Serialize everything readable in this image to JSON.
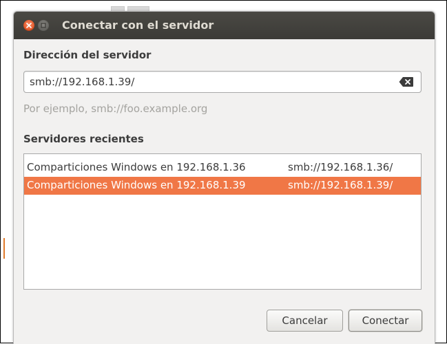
{
  "window": {
    "title": "Conectar con el servidor"
  },
  "server_address": {
    "label": "Dirección del servidor",
    "value": "smb://192.168.1.39/",
    "example": "Por ejemplo, smb://foo.example.org"
  },
  "recent_servers": {
    "label": "Servidores recientes",
    "items": [
      {
        "name": "Comparticiones Windows en 192.168.1.36",
        "uri": "smb://192.168.1.36/",
        "selected": false
      },
      {
        "name": "Comparticiones Windows en 192.168.1.39",
        "uri": "smb://192.168.1.39/",
        "selected": true
      }
    ]
  },
  "buttons": {
    "cancel": "Cancelar",
    "connect": "Conectar"
  },
  "colors": {
    "accent": "#f07746",
    "titlebar": "#3c3b37",
    "close_button": "#e45424"
  }
}
